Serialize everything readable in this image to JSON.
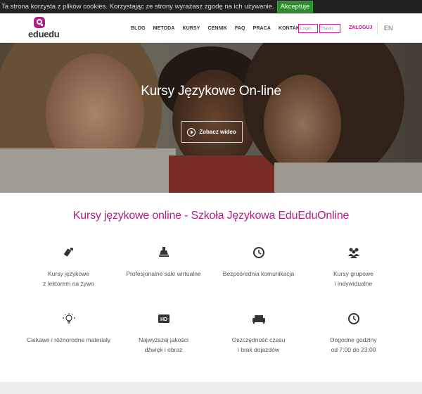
{
  "cookie": {
    "text": "Ta strona korzysta z plików cookies. Korzystając ze strony wyrażasz zgodę na ich używanie.",
    "accept_label": "Akceptuje"
  },
  "header": {
    "logo_text": "eduedu",
    "nav": [
      "BLOG",
      "METODA",
      "KURSY",
      "CENNIK",
      "FAQ",
      "PRACA",
      "KONTAKT"
    ],
    "login_placeholder": "Login",
    "password_placeholder": "Hasło",
    "login_button": "ZALOGUJ",
    "language": "EN"
  },
  "hero": {
    "title": "Kursy Językowe On-line",
    "video_button": "Zobacz wideo"
  },
  "main": {
    "title": "Kursy językowe online - Szkoła Językowa EduEduOnline",
    "features": [
      {
        "icon": "satellite-icon",
        "label": "Kursy językowe\nz lektorem na żywo"
      },
      {
        "icon": "lamp-icon",
        "label": "Profesjonalne sale wirtualne"
      },
      {
        "icon": "clock-icon",
        "label": "Bezpośrednia komunikacja"
      },
      {
        "icon": "group-icon",
        "label": "Kursy grupowe\ni indywidualne"
      },
      {
        "icon": "lightbulb-icon",
        "label": "Ciekawe i różnorodne materiały"
      },
      {
        "icon": "hd-icon",
        "label": "Najwyższej jakości\ndźwięk i obraz"
      },
      {
        "icon": "sofa-icon",
        "label": "Oszczędność czasu\ni brak dojazdów"
      },
      {
        "icon": "clock-icon",
        "label": "Dogodne godziny\nod 7:00 do 23:00"
      }
    ]
  },
  "colors": {
    "brand": "#b01f8a",
    "cookie_bg": "#222222",
    "accept": "#2e8b2e"
  }
}
